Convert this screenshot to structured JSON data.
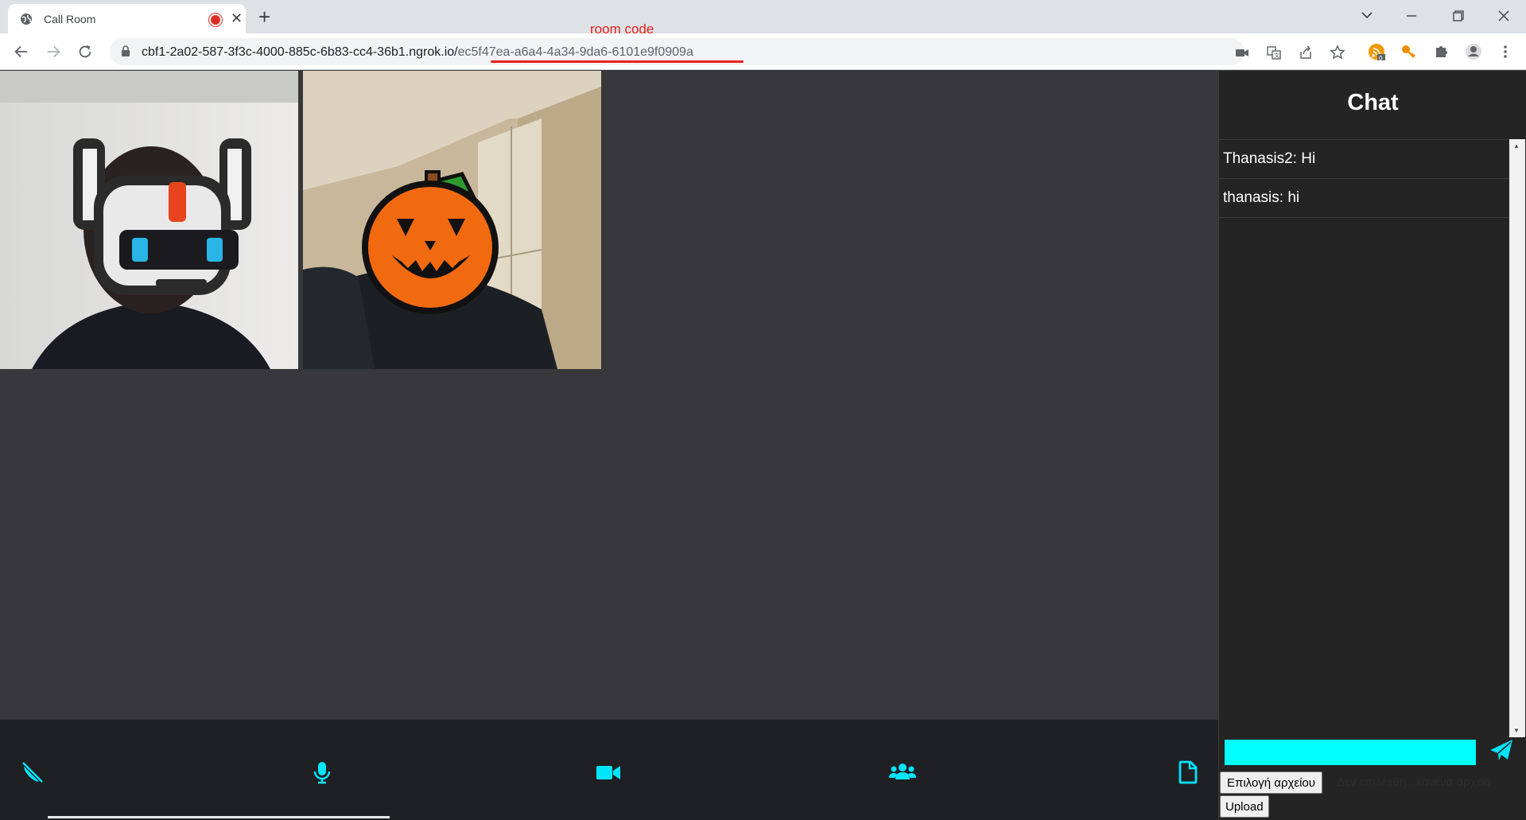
{
  "browser": {
    "tab_title": "Call Room",
    "tab_close": "✕",
    "new_tab": "+",
    "url_host": "cbf1-2a02-587-3f3c-4000-885c-6b83-cc4-36b1.ngrok.io/",
    "url_path": "ec5f47ea-a6a4-4a34-9da6-6101e9f0909a",
    "extension_badge": "0"
  },
  "annotation": {
    "label": "room code",
    "color": "#e5231c"
  },
  "chat": {
    "title": "Chat",
    "messages": [
      {
        "text": "Thanasis2: Hi"
      },
      {
        "text": "thanasis: hi"
      }
    ],
    "input_value": "",
    "file_button": "Επιλογή αρχείου",
    "file_status": "Δεν επιλέχθη...κανένα αρχείο",
    "upload_button": "Upload"
  },
  "controls": {
    "icons": [
      "phone-slash-icon",
      "microphone-icon",
      "video-camera-icon",
      "users-icon",
      "file-icon"
    ],
    "accent_color": "#00e5ff"
  },
  "videos": [
    {
      "participant": "robot-avatar-video"
    },
    {
      "participant": "pumpkin-avatar-video"
    }
  ],
  "colors": {
    "background": "#38373b",
    "controls_bar": "#1f2023",
    "chat_panel": "#242424",
    "chat_input": "#00ffff"
  }
}
